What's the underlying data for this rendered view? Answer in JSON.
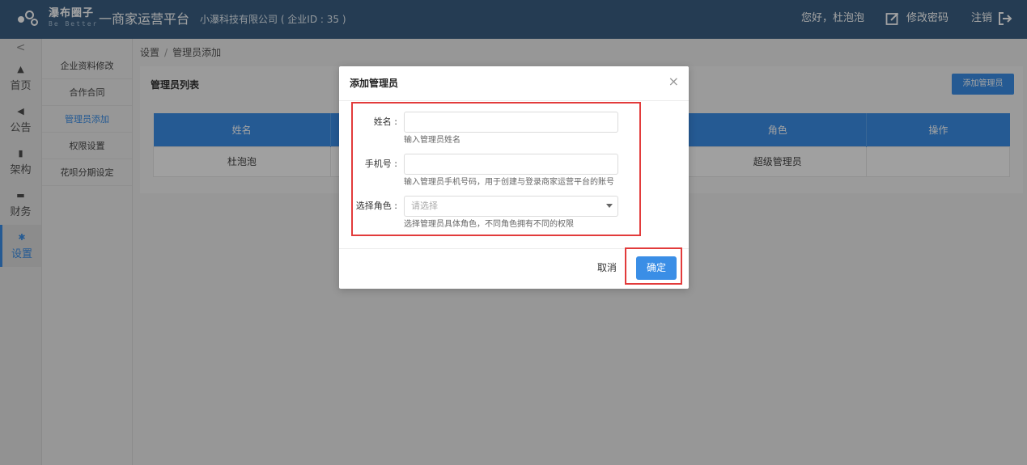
{
  "header": {
    "brand_cn": "瀑布圈子",
    "brand_en": "Be Better",
    "platform": "一商家运营平台",
    "company": "小瀑科技有限公司 ( 企业ID : 35 )",
    "greeting": "您好，杜泡泡",
    "change_password": "修改密码",
    "logout": "注销"
  },
  "nav": {
    "collapse": "<",
    "items": [
      {
        "label": "首页",
        "icon": "home-icon"
      },
      {
        "label": "公告",
        "icon": "megaphone-icon"
      },
      {
        "label": "架构",
        "icon": "structure-icon"
      },
      {
        "label": "财务",
        "icon": "finance-icon"
      },
      {
        "label": "设置",
        "icon": "gear-icon"
      }
    ]
  },
  "submenu": [
    "企业资料修改",
    "合作合同",
    "管理员添加",
    "权限设置",
    "花呗分期设定"
  ],
  "breadcrumb": {
    "root": "设置",
    "separator": "/",
    "current": "管理员添加"
  },
  "panel": {
    "title": "管理员列表",
    "add_button": "添加管理员",
    "columns": [
      "姓名",
      "角色",
      "操作"
    ],
    "rows": [
      {
        "name": "杜泡泡",
        "role": "超级管理员",
        "action": ""
      }
    ]
  },
  "dialog": {
    "title": "添加管理员",
    "close": "×",
    "fields": [
      {
        "label": "姓名 :",
        "value": "",
        "placeholder": "",
        "hint": "输入管理员姓名"
      },
      {
        "label": "手机号 :",
        "value": "",
        "placeholder": "",
        "hint": "输入管理员手机号码，用于创建与登录商家运营平台的账号"
      },
      {
        "label": "选择角色 :",
        "value": "请选择",
        "placeholder": "请选择",
        "hint": "选择管理员具体角色，不同角色拥有不同的权限"
      }
    ],
    "cancel": "取消",
    "confirm": "确定"
  },
  "colors": {
    "header": "#3a5f82",
    "accent": "#3a8ee6",
    "highlight": "#e23b3b"
  }
}
